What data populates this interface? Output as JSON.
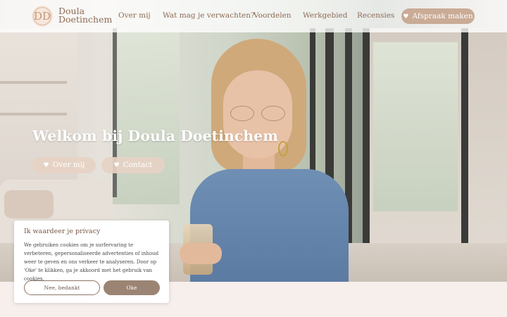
{
  "brand": {
    "line1": "Doula",
    "line2": "Doetinchem",
    "logo_letters": "DD"
  },
  "nav": {
    "items": [
      {
        "label": "Over mij"
      },
      {
        "label": "Wat mag je verwachten?"
      },
      {
        "label": "Voordelen"
      },
      {
        "label": "Werkgebied"
      },
      {
        "label": "Recensies"
      }
    ],
    "cta_label": "Afspraak maken",
    "cta_icon": "heart-icon"
  },
  "hero": {
    "title": "Welkom bij Doula Doetinchem",
    "buttons": [
      {
        "label": "Over mij",
        "icon": "heart-icon"
      },
      {
        "label": "Contact",
        "icon": "heart-icon"
      }
    ]
  },
  "cookie": {
    "title": "Ik waardeer je privacy",
    "text": "We gebruiken cookies om je surfervaring te verbeteren, gepersonaliseerde advertenties of inhoud weer te geven en ons verkeer te analyseren. Door op 'Oke' te klikken, ga je akkoord met het gebruik van cookies.",
    "decline_label": "Nee, bedankt",
    "accept_label": "Oke"
  },
  "colors": {
    "accent": "#c9ab96",
    "text_brown": "#8d6b55",
    "accept_button": "#9b8474",
    "page_bg": "#f7efec"
  }
}
